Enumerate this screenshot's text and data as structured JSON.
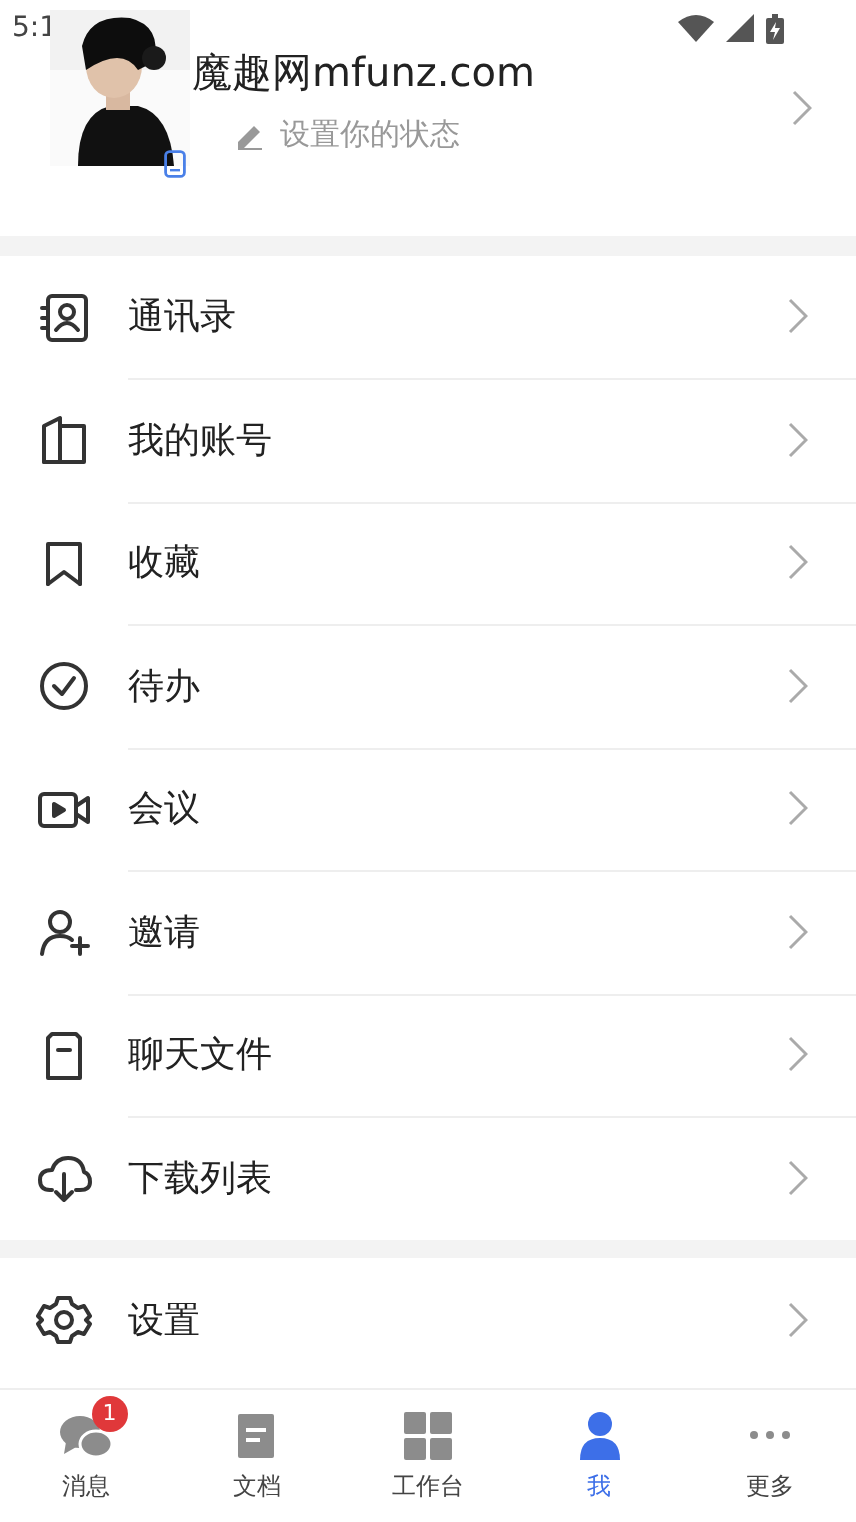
{
  "status_bar": {
    "time": "5:1"
  },
  "profile": {
    "name": "魔趣网mfunz.com",
    "status_placeholder": "设置你的状态"
  },
  "menu": [
    {
      "kind": "contacts",
      "label": "通讯录"
    },
    {
      "kind": "account",
      "label": "我的账号"
    },
    {
      "kind": "favorites",
      "label": "收藏"
    },
    {
      "kind": "todo",
      "label": "待办"
    },
    {
      "kind": "meeting",
      "label": "会议"
    },
    {
      "kind": "invite",
      "label": "邀请"
    },
    {
      "kind": "files",
      "label": "聊天文件"
    },
    {
      "kind": "download",
      "label": "下载列表"
    }
  ],
  "settings": {
    "kind": "settings",
    "label": "设置"
  },
  "tab_bar": [
    {
      "kind": "messages",
      "label": "消息",
      "badge": "1",
      "selected": false
    },
    {
      "kind": "docs",
      "label": "文档",
      "selected": false
    },
    {
      "kind": "workbench",
      "label": "工作台",
      "selected": false
    },
    {
      "kind": "me",
      "label": "我",
      "selected": true
    },
    {
      "kind": "more",
      "label": "更多",
      "selected": false
    }
  ]
}
